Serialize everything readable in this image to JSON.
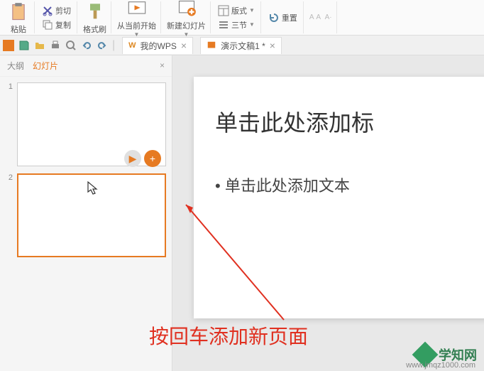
{
  "toolbar": {
    "paste": "粘贴",
    "cut": "剪切",
    "copy": "复制",
    "format_painter": "格式刷",
    "from_current": "从当前开始",
    "new_slide": "新建幻灯片",
    "layout": "版式",
    "sections": "三节",
    "reset": "重置"
  },
  "tabs": {
    "my_wps": "我的WPS",
    "doc": "演示文稿1 *"
  },
  "sidebar": {
    "outline": "大纲",
    "slides": "幻灯片",
    "num1": "1",
    "num2": "2"
  },
  "slide": {
    "title": "单击此处添加标",
    "body": "单击此处添加文本"
  },
  "annotation": "按回车添加新页面",
  "watermark": {
    "text": "学知网",
    "url": "www.jmqz1000.com"
  }
}
